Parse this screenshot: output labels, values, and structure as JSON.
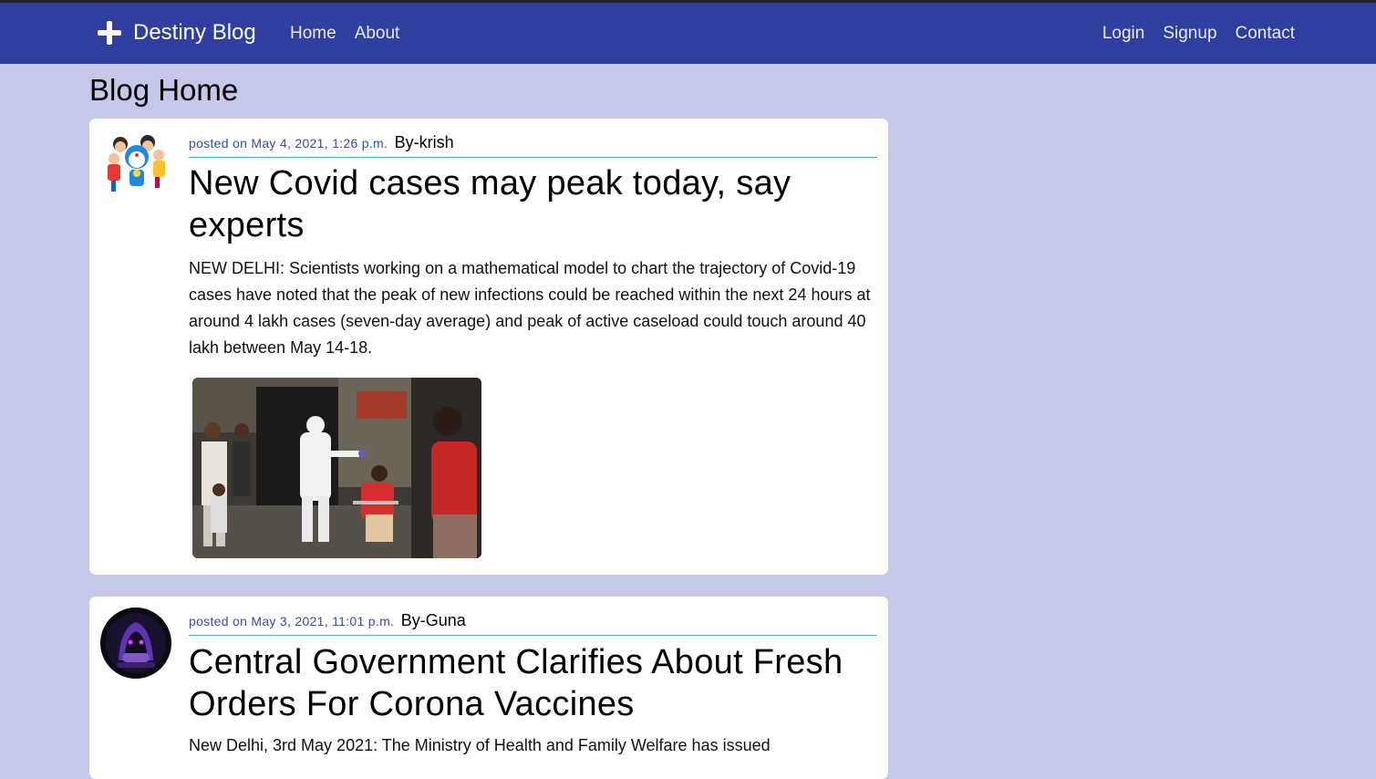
{
  "navbar": {
    "brand": "Destiny Blog",
    "left_links": [
      "Home",
      "About"
    ],
    "right_links": [
      "Login",
      "Signup",
      "Contact"
    ],
    "color": "#303f9f"
  },
  "page": {
    "title": "Blog Home"
  },
  "posts": [
    {
      "posted": "posted on May 4, 2021, 1:26 p.m.",
      "author": "By-krish",
      "title": "New Covid cases may peak today, say experts",
      "body": "NEW DELHI: Scientists working on a mathematical model to chart the trajectory of Covid-19 cases have noted that the peak of new infections could be reached within the next 24 hours at around 4 lakh cases (seven-day average) and peak of active caseload could touch around 40 lakh between May 14-18.",
      "avatar": "cartoon-avatar",
      "image": "covid-test-photo"
    },
    {
      "posted": "posted on May 3, 2021, 11:01 p.m.",
      "author": "By-Guna",
      "title": "Central Government Clarifies About Fresh Orders For Corona Vaccines",
      "body": "New Delhi, 3rd May 2021: The Ministry of Health and Family Welfare has issued",
      "avatar": "gamer-avatar"
    }
  ],
  "colors": {
    "background": "#c5c8e8",
    "meta_text": "#3949ab",
    "divider": "#4db6ac"
  }
}
